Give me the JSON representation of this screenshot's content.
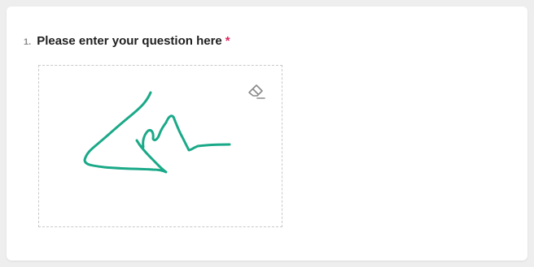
{
  "question": {
    "number": "1.",
    "text": "Please enter your question here",
    "required_mark": "*"
  },
  "signature_pad": {
    "has_signature": true,
    "eraser_icon": "eraser-icon"
  },
  "colors": {
    "required": "#e0245e",
    "stroke": "#1aa988",
    "icon": "#8a8a8a"
  }
}
